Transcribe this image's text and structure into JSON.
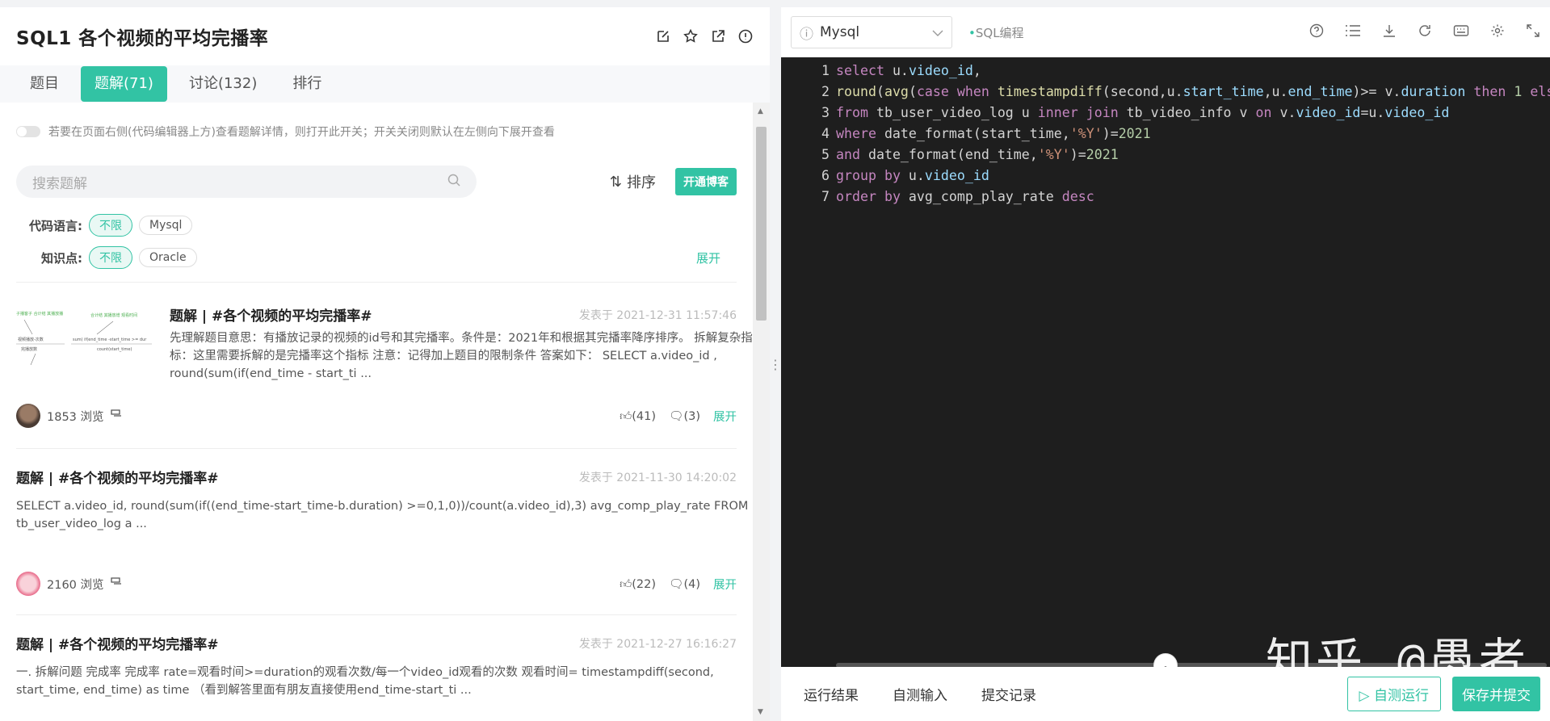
{
  "problem": {
    "title": "SQL1  各个视频的平均完播率",
    "tabs": [
      "题目",
      "题解(71)",
      "讨论(132)",
      "排行"
    ],
    "active_tab": "题解(71)"
  },
  "solutions": {
    "toggle_hint": "若要在页面右侧(代码编辑器上方)查看题解详情，则打开此开关；开关关闭则默认在左侧向下展开查看",
    "search_placeholder": "搜索题解",
    "sort_label": "排序",
    "blog_button": "开通博客",
    "filters": {
      "lang_label": "代码语言:",
      "lang_options": [
        "不限",
        "Mysql"
      ],
      "topic_label": "知识点:",
      "topic_options": [
        "不限",
        "Oracle"
      ],
      "expand": "展开"
    },
    "items": [
      {
        "title": "题解 | #各个视频的平均完播率#",
        "date": "发表于 2021-12-31 11:57:46",
        "desc": "先理解题目意思：有播放记录的视频的id号和其完播率。条件是：2021年和根据其完播率降序排序。 拆解复杂指标：这里需要拆解的是完播率这个指标 注意：记得加上题目的限制条件 答案如下： SELECT a.video_id , round(sum(if(end_time - start_ti ...",
        "views": "1853 浏览",
        "likes": "(41)",
        "comments": "(3)",
        "expand": "展开"
      },
      {
        "title": "题解 | #各个视频的平均完播率#",
        "date": "发表于 2021-11-30 14:20:02",
        "desc": "SELECT a.video_id, round(sum(if((end_time-start_time-b.duration) >=0,1,0))/count(a.video_id),3) avg_comp_play_rate FROM tb_user_video_log a ...",
        "views": "2160 浏览",
        "likes": "(22)",
        "comments": "(4)",
        "expand": "展开"
      },
      {
        "title": "题解 | #各个视频的平均完播率#",
        "date": "发表于 2021-12-27 16:16:27",
        "desc": "一. 拆解问题 完成率 完成率 rate=观看时间>=duration的观看次数/每一个video_id观看的次数 观看时间= timestampdiff(second, start_time, end_time) as time （看到解答里面有朋友直接使用end_time-start_ti ..."
      }
    ],
    "thumb_text": [
      "子播客子 合计结 其播放播",
      "视频播放-次数",
      "完播放数",
      "sum( if(end_time -start_time >= dur",
      "count(start_time)",
      "合计结 其播放增 观看时间"
    ]
  },
  "editor": {
    "language": "Mysql",
    "mode_tag": "SQL编程",
    "bottom_tabs": [
      "运行结果",
      "自测输入",
      "提交记录"
    ],
    "run_button": "自测运行",
    "submit_button": "保存并提交",
    "watermark": "知乎 @愚者"
  },
  "code_lines": [
    [
      [
        "kw",
        "select"
      ],
      [
        "pl",
        " u."
      ],
      [
        "id",
        "video_id"
      ],
      [
        "pl",
        ","
      ]
    ],
    [
      [
        "fn",
        "round"
      ],
      [
        "pl",
        "("
      ],
      [
        "fn",
        "avg"
      ],
      [
        "pl",
        "("
      ],
      [
        "kw",
        "case"
      ],
      [
        "pl",
        " "
      ],
      [
        "kw",
        "when"
      ],
      [
        "pl",
        " "
      ],
      [
        "fn",
        "timestampdiff"
      ],
      [
        "pl",
        "(second,u."
      ],
      [
        "id",
        "start_time"
      ],
      [
        "pl",
        ",u."
      ],
      [
        "id",
        "end_time"
      ],
      [
        "pl",
        ")>= v."
      ],
      [
        "id",
        "duration"
      ],
      [
        "pl",
        " "
      ],
      [
        "kw",
        "then"
      ],
      [
        "pl",
        " "
      ],
      [
        "nm",
        "1"
      ],
      [
        "pl",
        " "
      ],
      [
        "kw",
        "else"
      ],
      [
        "pl",
        " "
      ],
      [
        "nm",
        "0"
      ]
    ],
    [
      [
        "kw",
        "from"
      ],
      [
        "pl",
        " tb_user_video_log u "
      ],
      [
        "kw",
        "inner"
      ],
      [
        "pl",
        " "
      ],
      [
        "kw",
        "join"
      ],
      [
        "pl",
        " tb_video_info v "
      ],
      [
        "kw",
        "on"
      ],
      [
        "pl",
        " v."
      ],
      [
        "id",
        "video_id"
      ],
      [
        "pl",
        "=u."
      ],
      [
        "id",
        "video_id"
      ]
    ],
    [
      [
        "kw",
        "where"
      ],
      [
        "pl",
        " date_format(start_time,"
      ],
      [
        "st",
        "'%Y'"
      ],
      [
        "pl",
        ")="
      ],
      [
        "nm",
        "2021"
      ]
    ],
    [
      [
        "kw",
        "and"
      ],
      [
        "pl",
        " date_format(end_time,"
      ],
      [
        "st",
        "'%Y'"
      ],
      [
        "pl",
        ")="
      ],
      [
        "nm",
        "2021"
      ]
    ],
    [
      [
        "kw",
        "group"
      ],
      [
        "pl",
        " "
      ],
      [
        "kw",
        "by"
      ],
      [
        "pl",
        " u."
      ],
      [
        "id",
        "video_id"
      ]
    ],
    [
      [
        "kw",
        "order"
      ],
      [
        "pl",
        " "
      ],
      [
        "kw",
        "by"
      ],
      [
        "pl",
        " avg_comp_play_rate "
      ],
      [
        "kw",
        "desc"
      ]
    ]
  ],
  "colors": {
    "accent": "#32c3a4",
    "editor_bg": "#1e1e1e"
  }
}
